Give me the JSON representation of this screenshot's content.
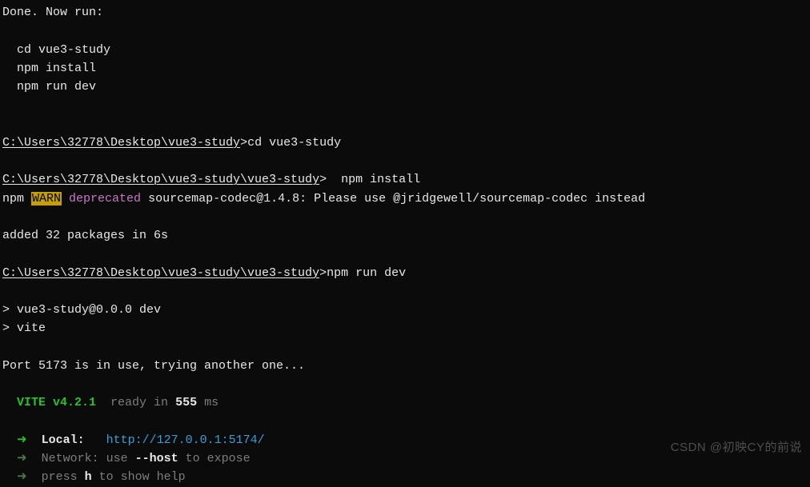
{
  "done_line": "Done. Now run:",
  "step_cd": "  cd vue3-study",
  "step_install": "  npm install",
  "step_dev": "  npm run dev",
  "prompt1_path": "C:\\Users\\32778\\Desktop\\vue3-study",
  "prompt1_cmd": "cd vue3-study",
  "prompt2_path": "C:\\Users\\32778\\Desktop\\vue3-study\\vue3-study",
  "prompt2_cmd": " npm install",
  "npm_prefix": "npm ",
  "warn_label": "WARN",
  "deprecated_label": " deprecated",
  "deprecated_msg": " sourcemap-codec@1.4.8: Please use @jridgewell/sourcemap-codec instead",
  "added_line": "added 32 packages in 6s",
  "prompt3_path": "C:\\Users\\32778\\Desktop\\vue3-study\\vue3-study",
  "prompt3_cmd": "npm run dev",
  "script_line1": "> vue3-study@0.0.0 dev",
  "script_line2": "> vite",
  "port_line": "Port 5173 is in use, trying another one...",
  "vite_version": "  VITE v4.2.1",
  "ready_in": "  ready in ",
  "ready_ms": "555 ",
  "ready_unit": "ms",
  "arrow": "  ➜  ",
  "local_label": "Local:   ",
  "local_url": "http://127.0.0.1:5174/",
  "network_label": "Network: use ",
  "network_host": "--host",
  "network_tail": " to expose",
  "help_pre": "press ",
  "help_key": "h",
  "help_tail": " to show help",
  "watermark": "CSDN @初映CY的前说"
}
